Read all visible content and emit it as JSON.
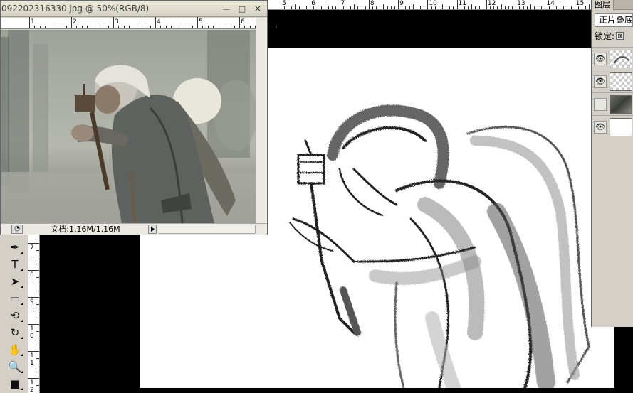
{
  "document_window": {
    "title": "092202316330.jpg @ 50%(RGB/8)",
    "minimize": "—",
    "maximize": "□",
    "close": "✕",
    "ruler_numbers": [
      "1",
      "2",
      "3",
      "4",
      "5",
      "6"
    ],
    "status_doc": "文档:1.16M/1.16M",
    "status_icon": "zoom-icon"
  },
  "main_ruler": {
    "numbers": [
      "5",
      "6",
      "7",
      "8",
      "9",
      "10",
      "11",
      "12",
      "13",
      "14",
      "15"
    ]
  },
  "vertical_ruler": {
    "numbers": [
      "7",
      "8",
      "9",
      "1\n0",
      "1\n1",
      "1\n2"
    ]
  },
  "tools": [
    {
      "name": "pen-tool-icon",
      "glyph": "✒"
    },
    {
      "name": "type-tool-icon",
      "glyph": "T"
    },
    {
      "name": "path-selection-icon",
      "glyph": "➤"
    },
    {
      "name": "rectangle-tool-icon",
      "glyph": "▭"
    },
    {
      "name": "3d-rotate-icon",
      "glyph": "⟲"
    },
    {
      "name": "3d-orbit-icon",
      "glyph": "↻"
    },
    {
      "name": "hand-tool-icon",
      "glyph": "✋"
    },
    {
      "name": "zoom-tool-icon",
      "glyph": "🔍"
    },
    {
      "name": "color-swatch-icon",
      "glyph": "■"
    }
  ],
  "layers_panel": {
    "tab_label": "图层",
    "blend_mode": "正片叠底",
    "lock_label": "锁定:",
    "layers": [
      {
        "visible": true,
        "thumb": "sketch"
      },
      {
        "visible": true,
        "thumb": "transparent"
      },
      {
        "visible": false,
        "thumb": "photo"
      },
      {
        "visible": true,
        "thumb": "white"
      }
    ]
  },
  "colors": {
    "chrome": "#d4d0c8",
    "canvas": "#ffffff",
    "workspace": "#000000"
  }
}
